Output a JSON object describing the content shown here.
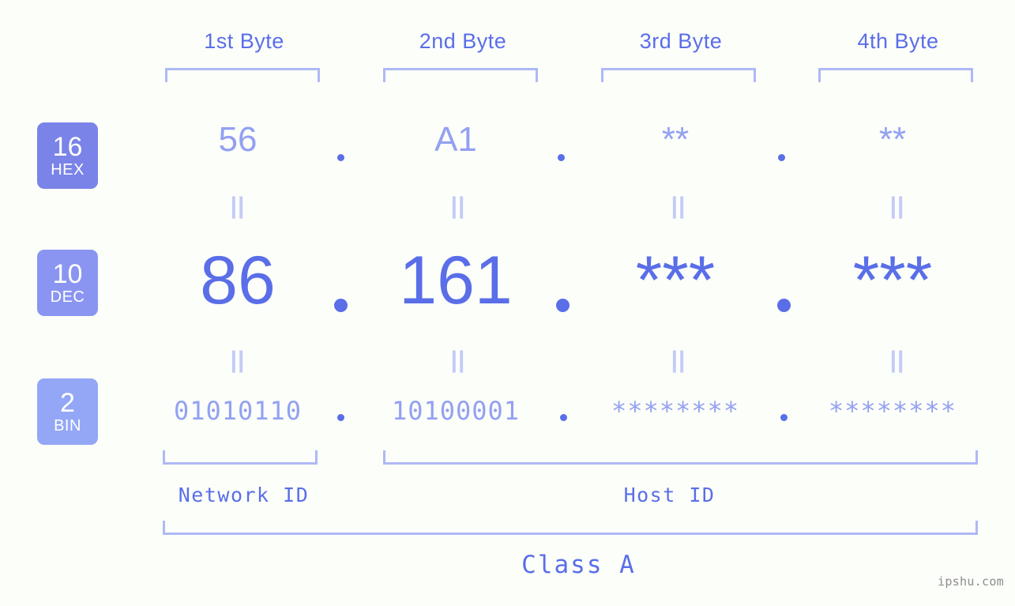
{
  "background_color": "#fcfefa",
  "accent_colors": {
    "strong_blue": "#5a6ee8",
    "light_blue": "#93a0f2",
    "bracket_blue": "#aeb9f5",
    "eq_mark_blue": "#c3cbf8",
    "badge_hex": "#7a83e7",
    "badge_dec": "#8a95f1",
    "badge_bin": "#93a7f6",
    "watermark_gray": "#8c8c8c"
  },
  "byte_headers": [
    {
      "label": "1st Byte"
    },
    {
      "label": "2nd Byte"
    },
    {
      "label": "3rd Byte"
    },
    {
      "label": "4th Byte"
    }
  ],
  "rows": [
    {
      "id": "hex",
      "badge_number": "16",
      "badge_name": "HEX",
      "badge_color": "#7a83e7",
      "values": [
        "56",
        "A1",
        "**",
        "**"
      ],
      "separator": "."
    },
    {
      "id": "dec",
      "badge_number": "10",
      "badge_name": "DEC",
      "badge_color": "#8a95f1",
      "values": [
        "86",
        "161",
        "***",
        "***"
      ],
      "separator": "."
    },
    {
      "id": "bin",
      "badge_number": "2",
      "badge_name": "BIN",
      "badge_color": "#93a7f6",
      "values": [
        "01010110",
        "10100001",
        "********",
        "********"
      ],
      "separator": "."
    }
  ],
  "equality_marks": {
    "glyph": "||",
    "count_per_gap": 4,
    "gaps": 2
  },
  "id_sections": [
    {
      "label": "Network ID",
      "spans_bytes": [
        1
      ]
    },
    {
      "label": "Host ID",
      "spans_bytes": [
        2,
        3,
        4
      ]
    }
  ],
  "class_section": {
    "label": "Class A",
    "spans_bytes": [
      1,
      2,
      3,
      4
    ]
  },
  "watermark": {
    "text": "ipshu.com"
  }
}
